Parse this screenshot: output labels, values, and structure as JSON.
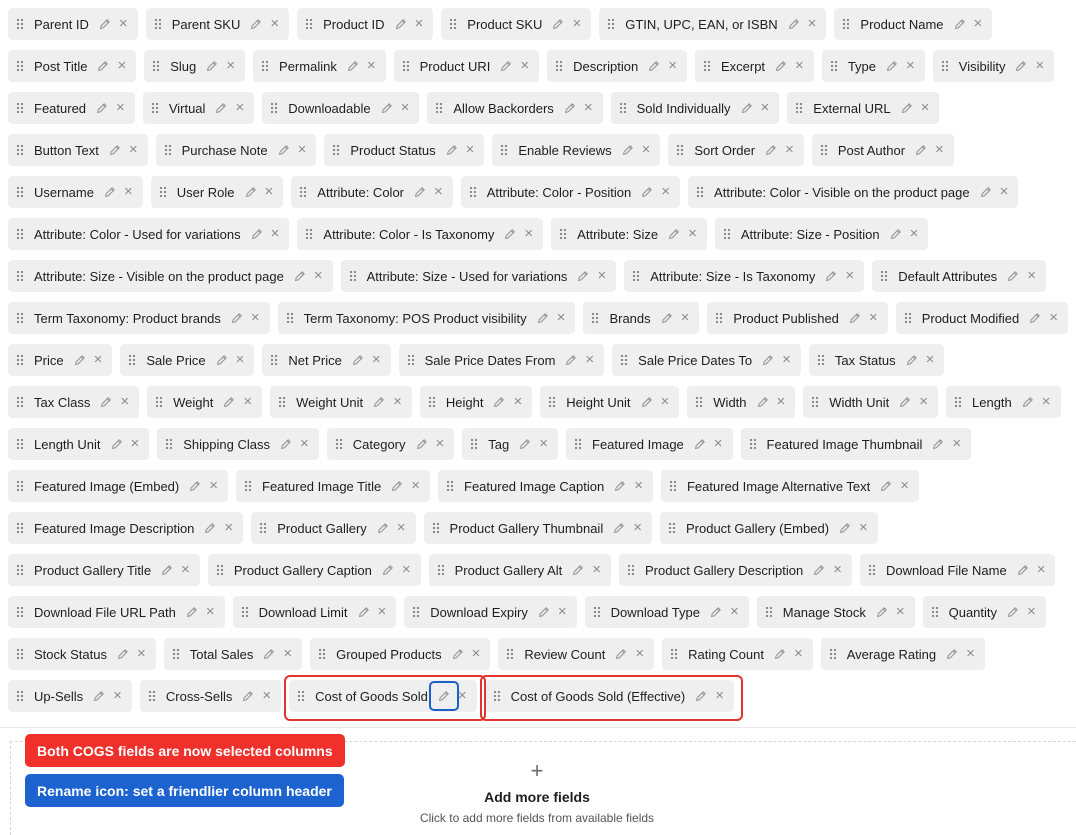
{
  "fields": [
    "Parent ID",
    "Parent SKU",
    "Product ID",
    "Product SKU",
    "GTIN, UPC, EAN, or ISBN",
    "Product Name",
    "Post Title",
    "Slug",
    "Permalink",
    "Product URI",
    "Description",
    "Excerpt",
    "Type",
    "Visibility",
    "Featured",
    "Virtual",
    "Downloadable",
    "Allow Backorders",
    "Sold Individually",
    "External URL",
    "Button Text",
    "Purchase Note",
    "Product Status",
    "Enable Reviews",
    "Sort Order",
    "Post Author",
    "Username",
    "User Role",
    "Attribute: Color",
    "Attribute: Color - Position",
    "Attribute: Color - Visible on the product page",
    "Attribute: Color - Used for variations",
    "Attribute: Color - Is Taxonomy",
    "Attribute: Size",
    "Attribute: Size - Position",
    "Attribute: Size - Visible on the product page",
    "Attribute: Size - Used for variations",
    "Attribute: Size - Is Taxonomy",
    "Default Attributes",
    "Term Taxonomy: Product brands",
    "Term Taxonomy: POS Product visibility",
    "Brands",
    "Product Published",
    "Product Modified",
    "Price",
    "Sale Price",
    "Net Price",
    "Sale Price Dates From",
    "Sale Price Dates To",
    "Tax Status",
    "Tax Class",
    "Weight",
    "Weight Unit",
    "Height",
    "Height Unit",
    "Width",
    "Width Unit",
    "Length",
    "Length Unit",
    "Shipping Class",
    "Category",
    "Tag",
    "Featured Image",
    "Featured Image Thumbnail",
    "Featured Image (Embed)",
    "Featured Image Title",
    "Featured Image Caption",
    "Featured Image Alternative Text",
    "Featured Image Description",
    "Product Gallery",
    "Product Gallery Thumbnail",
    "Product Gallery (Embed)",
    "Product Gallery Title",
    "Product Gallery Caption",
    "Product Gallery Alt",
    "Product Gallery Description",
    "Download File Name",
    "Download File URL Path",
    "Download Limit",
    "Download Expiry",
    "Download Type",
    "Manage Stock",
    "Quantity",
    "Stock Status",
    "Total Sales",
    "Grouped Products",
    "Review Count",
    "Rating Count",
    "Average Rating",
    "Up-Sells",
    "Cross-Sells",
    "Cost of Goods Sold",
    "Cost of Goods Sold (Effective)"
  ],
  "icons": {
    "drag": "drag-handle-icon",
    "edit": "pencil-icon",
    "remove": "close-icon",
    "add": "plus-icon"
  },
  "add_more": {
    "plus": "+",
    "title": "Add more fields",
    "subtitle": "Click to add more fields from available fields"
  },
  "annotations": {
    "cogs_selected": "Both COGS fields are now selected columns",
    "rename_icon": "Rename icon: set a friendlier column header"
  },
  "colors": {
    "chip_background": "#efefef",
    "highlight_red": "#e33432",
    "highlight_blue": "#1d5fc9",
    "note_red": "#f0302a",
    "note_blue": "#1d63d0"
  }
}
